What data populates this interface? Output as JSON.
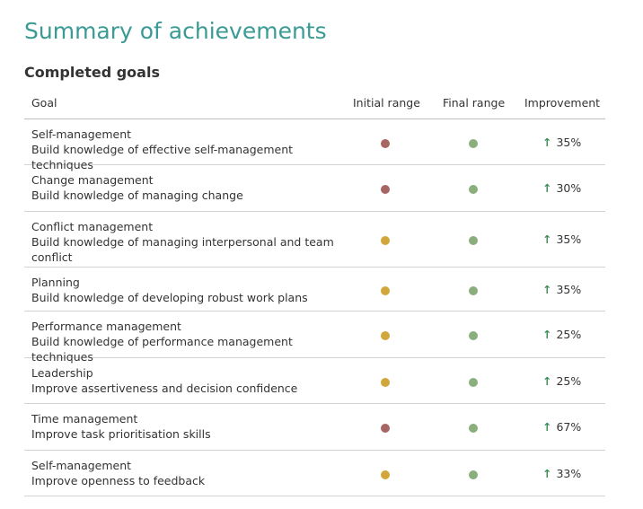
{
  "title": "Summary of achievements",
  "subtitle": "Completed goals",
  "headers": {
    "goal": "Goal",
    "initial": "Initial range",
    "final": "Final range",
    "improvement": "Improvement"
  },
  "colors": {
    "red": "#a86663",
    "yellow": "#d2a63a",
    "green": "#8aaf7d",
    "accent": "#3a9a94",
    "arrow": "#3e8e58"
  },
  "rows": [
    {
      "title": "Self-management",
      "desc": "Build knowledge of effective self-management techniques",
      "initial": "red",
      "final": "green",
      "improvement": "35%"
    },
    {
      "title": "Change management",
      "desc": "Build knowledge of managing change",
      "initial": "red",
      "final": "green",
      "improvement": "30%"
    },
    {
      "title": "Conflict management",
      "desc": "Build knowledge of managing interpersonal and team conflict",
      "initial": "yellow",
      "final": "green",
      "improvement": "35%"
    },
    {
      "title": "Planning",
      "desc": "Build knowledge of developing robust work plans",
      "initial": "yellow",
      "final": "green",
      "improvement": "35%"
    },
    {
      "title": "Performance management",
      "desc": "Build knowledge of performance management techniques",
      "initial": "yellow",
      "final": "green",
      "improvement": "25%"
    },
    {
      "title": "Leadership",
      "desc": "Improve assertiveness and decision confidence",
      "initial": "yellow",
      "final": "green",
      "improvement": "25%"
    },
    {
      "title": "Time management",
      "desc": "Improve task prioritisation skills",
      "initial": "red",
      "final": "green",
      "improvement": "67%"
    },
    {
      "title": "Self-management",
      "desc": "Improve openness to feedback",
      "initial": "yellow",
      "final": "green",
      "improvement": "33%"
    }
  ]
}
